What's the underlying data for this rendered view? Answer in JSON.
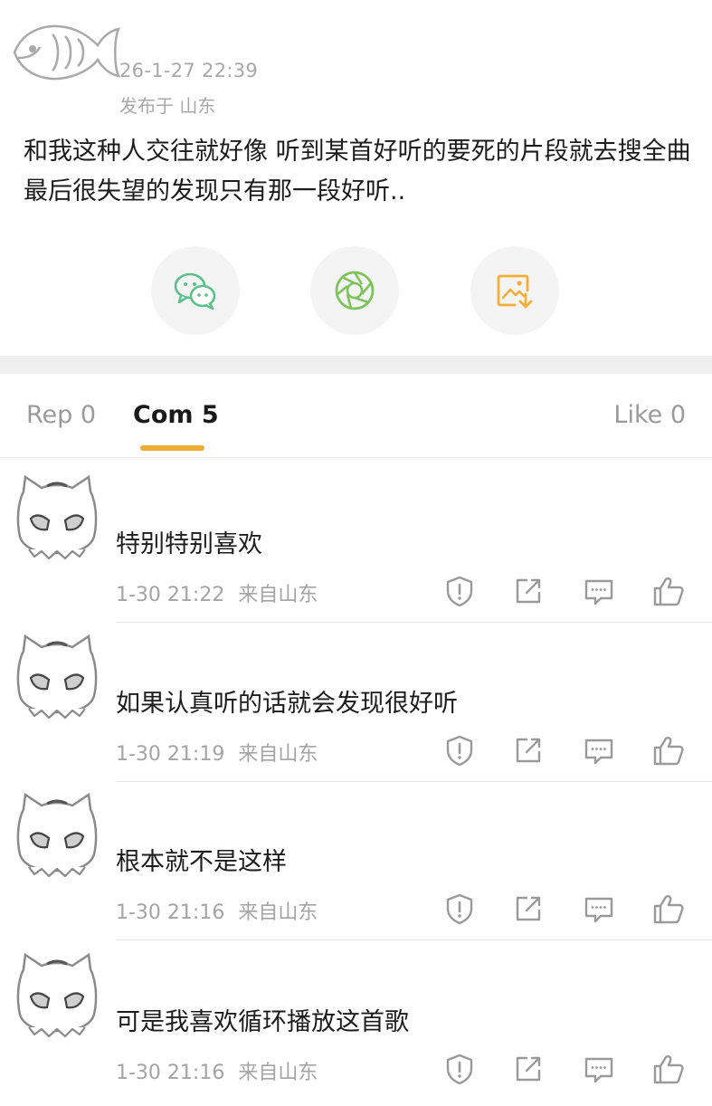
{
  "post": {
    "timestamp": "26-1-27 22:39",
    "location": "发布于 山东",
    "content": "和我这种人交往就好像 听到某首好听的要死的片段就去搜全曲 最后很失望的发现只有那一段好听.."
  },
  "share": {
    "wechat_icon": "wechat-icon",
    "moments_icon": "moments-icon",
    "save_image_icon": "save-image-icon",
    "colors": {
      "wechat": "#5bc08a",
      "moments": "#7ec35c",
      "save_image": "#f3ad3a"
    }
  },
  "tabs": {
    "repost_label": "Rep 0",
    "comment_label": "Com 5",
    "like_label": "Like 0",
    "active_color": "#f0ad32"
  },
  "comments": [
    {
      "text": "特别特别喜欢",
      "time": "1-30 21:22",
      "from": "来自山东"
    },
    {
      "text": "如果认真听的话就会发现很好听",
      "time": "1-30 21:19",
      "from": "来自山东"
    },
    {
      "text": "根本就不是这样",
      "time": "1-30 21:16",
      "from": "来自山东"
    },
    {
      "text": "可是我喜欢循环播放这首歌",
      "time": "1-30 21:16",
      "from": "来自山东"
    }
  ]
}
